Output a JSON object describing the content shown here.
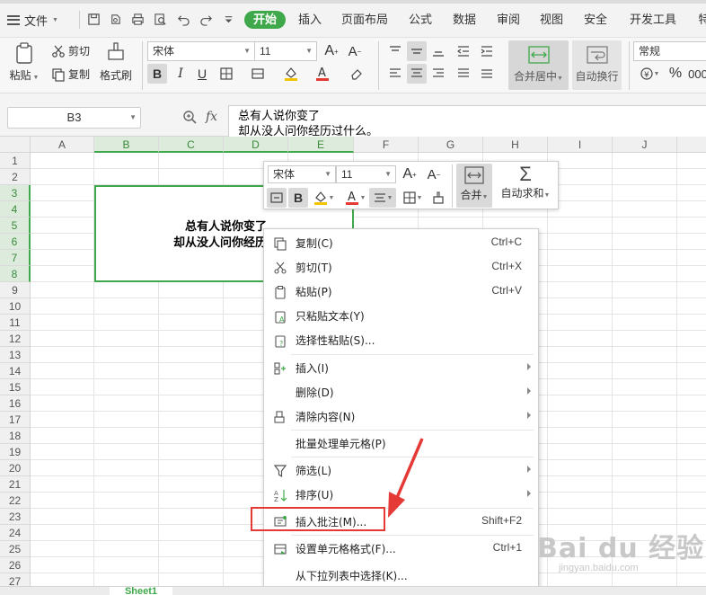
{
  "menubar": {
    "file_label": "文件",
    "tabs": [
      "开始",
      "插入",
      "页面布局",
      "公式",
      "数据",
      "审阅",
      "视图",
      "安全",
      "开发工具",
      "特"
    ],
    "active_tab": "开始"
  },
  "ribbon": {
    "paste": "粘贴",
    "cut": "剪切",
    "copy": "复制",
    "format_painter": "格式刷",
    "font_name": "宋体",
    "font_size": "11",
    "merge_center": "合并居中",
    "wrap_text": "自动换行",
    "number_format": "常规",
    "percent": "%"
  },
  "formula_bar": {
    "name_box": "B3",
    "fx": "fx",
    "content_line1": "总有人说你变了",
    "content_line2": "却从没人问你经历过什么。"
  },
  "grid": {
    "columns": [
      "A",
      "B",
      "C",
      "D",
      "E",
      "F",
      "G",
      "H",
      "I",
      "J"
    ],
    "rows": [
      "1",
      "2",
      "3",
      "4",
      "5",
      "6",
      "7",
      "8",
      "9",
      "10",
      "11",
      "12",
      "13",
      "14",
      "15",
      "16",
      "17",
      "18",
      "19",
      "20",
      "21",
      "22",
      "23",
      "24",
      "25",
      "26",
      "27"
    ],
    "cell_line1": "总有人说你变了",
    "cell_line2": "却从没人问你经历过"
  },
  "mini_toolbar": {
    "font_name": "宋体",
    "font_size": "11",
    "bold": "B",
    "merge": "合并",
    "autosum": "自动求和"
  },
  "context_menu": {
    "items": [
      {
        "label": "复制(C)",
        "shortcut": "Ctrl+C"
      },
      {
        "label": "剪切(T)",
        "shortcut": "Ctrl+X"
      },
      {
        "label": "粘贴(P)",
        "shortcut": "Ctrl+V"
      },
      {
        "label": "只粘贴文本(Y)",
        "shortcut": ""
      },
      {
        "label": "选择性粘贴(S)...",
        "shortcut": ""
      },
      {
        "label": "插入(I)",
        "shortcut": ""
      },
      {
        "label": "删除(D)",
        "shortcut": ""
      },
      {
        "label": "清除内容(N)",
        "shortcut": ""
      },
      {
        "label": "批量处理单元格(P)",
        "shortcut": ""
      },
      {
        "label": "筛选(L)",
        "shortcut": ""
      },
      {
        "label": "排序(U)",
        "shortcut": ""
      },
      {
        "label": "插入批注(M)...",
        "shortcut": "Shift+F2"
      },
      {
        "label": "设置单元格格式(F)...",
        "shortcut": "Ctrl+1"
      },
      {
        "label": "从下拉列表中选择(K)...",
        "shortcut": ""
      }
    ]
  },
  "sheet_tab": "Sheet1",
  "watermark": {
    "main": "Bai du 经验",
    "sub": "jingyan.baidu.com"
  },
  "colors": {
    "accent": "#3fa84a",
    "annotation": "#e53935"
  }
}
